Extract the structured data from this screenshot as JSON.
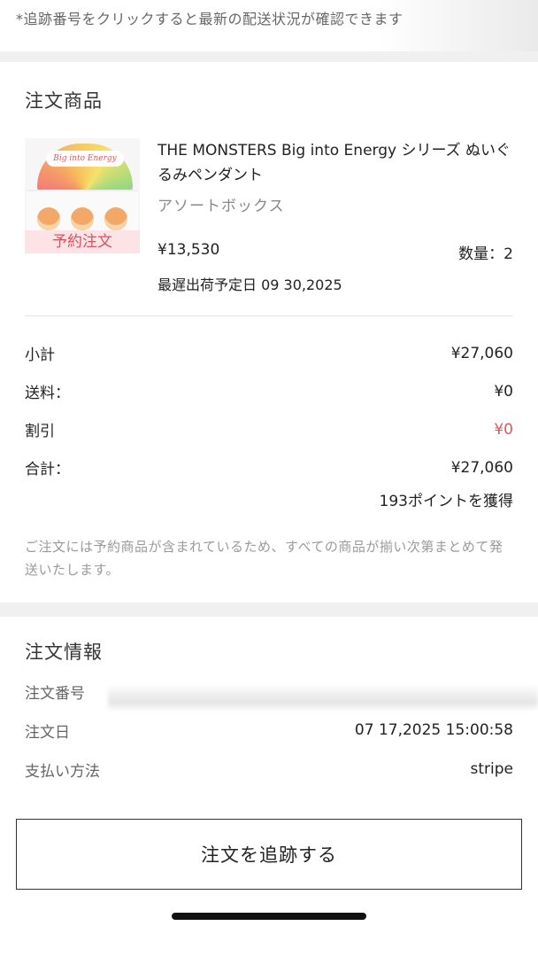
{
  "tracking_note": "*追跡番号をクリックすると最新の配送状況が確認できます",
  "order_items": {
    "title": "注文商品",
    "product": {
      "name": "THE MONSTERS Big into Energy シリーズ ぬいぐるみペンダント",
      "variant": "アソートボックス",
      "price": "¥13,530",
      "quantity": "数量：2",
      "ship_date": "最遅出荷予定日 09 30,2025",
      "preorder_tag": "予約注文",
      "image_logo": "Big into Energy"
    },
    "summary": {
      "subtotal_label": "小計",
      "subtotal_value": "¥27,060",
      "shipping_label": "送料：",
      "shipping_value": "¥0",
      "discount_label": "割引",
      "discount_value": "¥0",
      "total_label": "合計：",
      "total_value": "¥27,060",
      "points": "193ポイントを獲得"
    },
    "preorder_note": "ご注文には予約商品が含まれているため、すべての商品が揃い次第まとめて発送いたします。"
  },
  "order_info": {
    "title": "注文情報",
    "order_number_label": "注文番号",
    "order_date_label": "注文日",
    "order_date_value": "07 17,2025 15:00:58",
    "payment_label": "支払い方法",
    "payment_value": "stripe"
  },
  "track_button": "注文を追跡する",
  "colors": {
    "discount_red": "#e05656",
    "preorder_tag_bg": "#fbe3e6",
    "preorder_tag_text": "#e0505b"
  }
}
